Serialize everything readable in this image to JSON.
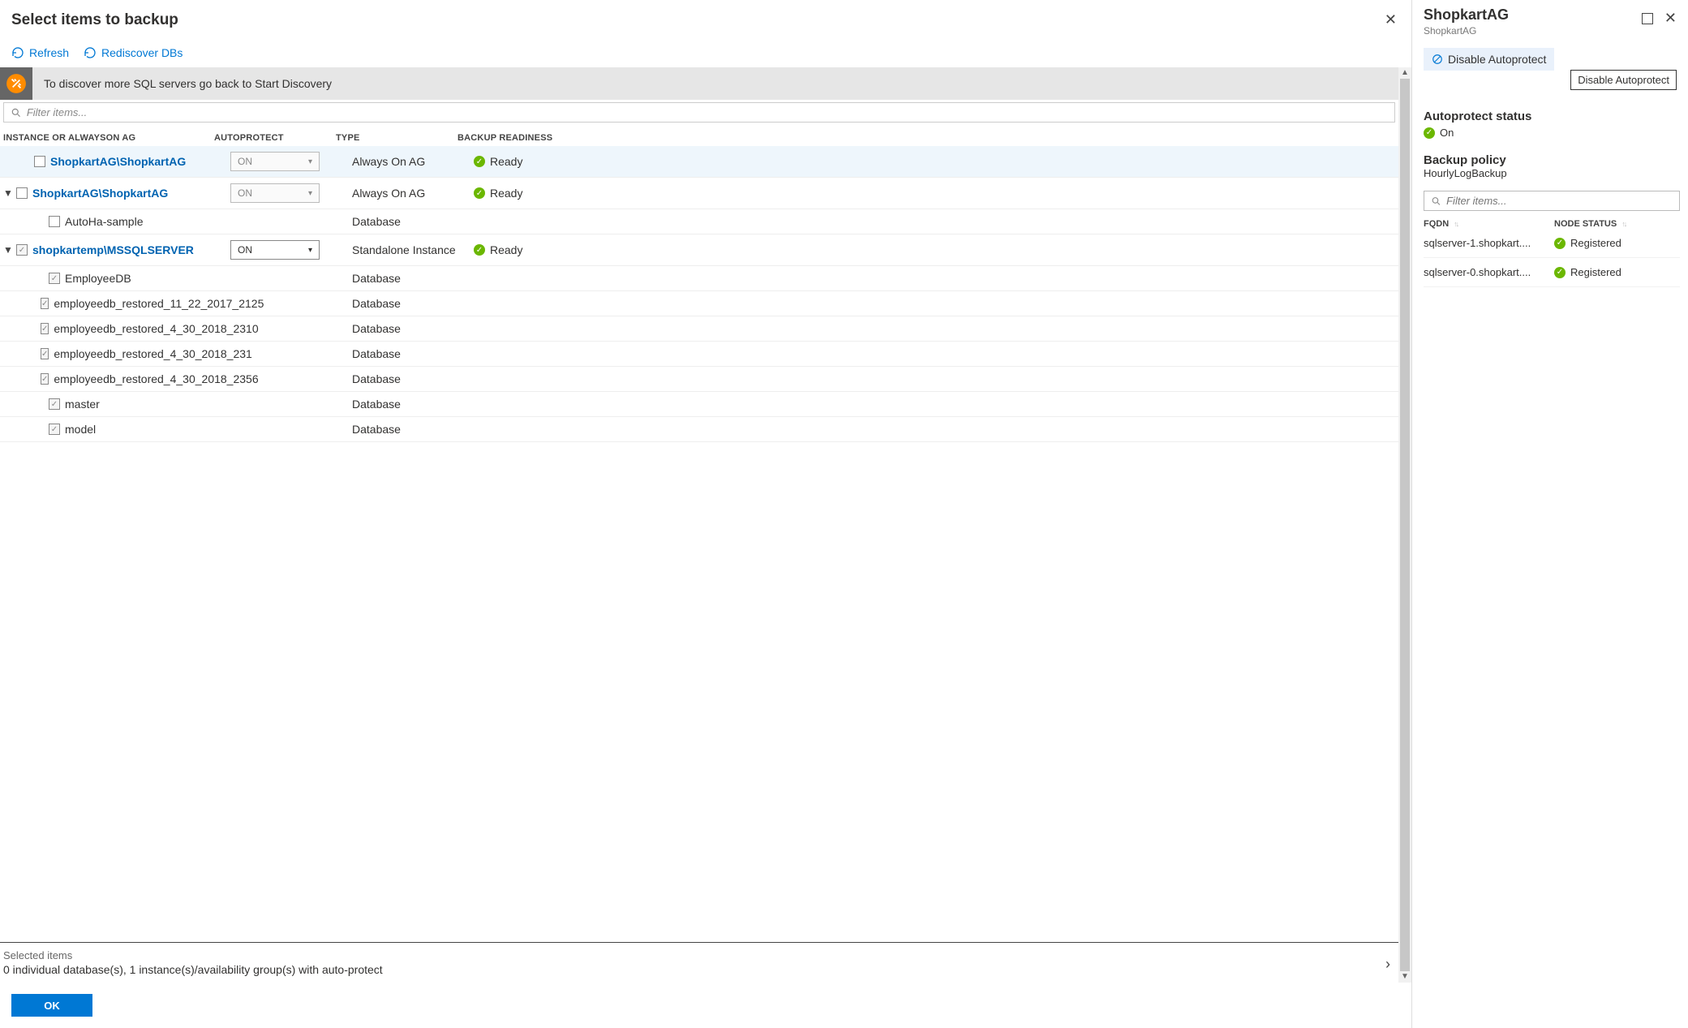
{
  "left": {
    "title": "Select items to backup",
    "toolbar": {
      "refresh": "Refresh",
      "rediscover": "Rediscover DBs"
    },
    "banner": "To discover more SQL servers go back to Start Discovery",
    "filter_placeholder": "Filter items...",
    "columns": {
      "name": "INSTANCE OR ALWAYSON AG",
      "autoprotect": "AUTOPROTECT",
      "type": "TYPE",
      "readiness": "BACKUP READINESS"
    },
    "rows": [
      {
        "caret": "",
        "indent": 1,
        "checked": false,
        "dim": false,
        "link": true,
        "name": "ShopkartAG\\ShopkartAG",
        "ap": "ON",
        "apDim": true,
        "type": "Always On AG",
        "ready": "Ready",
        "readyIcon": true,
        "highlight": true
      },
      {
        "caret": "▼",
        "indent": 0,
        "checked": false,
        "dim": false,
        "link": true,
        "name": "ShopkartAG\\ShopkartAG",
        "ap": "ON",
        "apDim": true,
        "type": "Always On AG",
        "ready": "Ready",
        "readyIcon": true,
        "highlight": false
      },
      {
        "caret": "",
        "indent": 2,
        "checked": false,
        "dim": false,
        "link": false,
        "name": "AutoHa-sample",
        "ap": "",
        "apDim": false,
        "type": "Database",
        "ready": "",
        "readyIcon": false,
        "highlight": false
      },
      {
        "caret": "▼",
        "indent": 0,
        "checked": true,
        "dim": true,
        "link": true,
        "name": "shopkartemp\\MSSQLSERVER",
        "ap": "ON",
        "apDim": false,
        "type": "Standalone Instance",
        "ready": "Ready",
        "readyIcon": true,
        "highlight": false
      },
      {
        "caret": "",
        "indent": 2,
        "checked": true,
        "dim": true,
        "link": false,
        "name": "EmployeeDB",
        "ap": "",
        "apDim": false,
        "type": "Database",
        "ready": "",
        "readyIcon": false,
        "highlight": false
      },
      {
        "caret": "",
        "indent": 2,
        "checked": true,
        "dim": true,
        "link": false,
        "name": "employeedb_restored_11_22_2017_2125",
        "ap": "",
        "apDim": false,
        "type": "Database",
        "ready": "",
        "readyIcon": false,
        "highlight": false
      },
      {
        "caret": "",
        "indent": 2,
        "checked": true,
        "dim": true,
        "link": false,
        "name": "employeedb_restored_4_30_2018_2310",
        "ap": "",
        "apDim": false,
        "type": "Database",
        "ready": "",
        "readyIcon": false,
        "highlight": false
      },
      {
        "caret": "",
        "indent": 2,
        "checked": true,
        "dim": true,
        "link": false,
        "name": "employeedb_restored_4_30_2018_231",
        "ap": "",
        "apDim": false,
        "type": "Database",
        "ready": "",
        "readyIcon": false,
        "highlight": false
      },
      {
        "caret": "",
        "indent": 2,
        "checked": true,
        "dim": true,
        "link": false,
        "name": "employeedb_restored_4_30_2018_2356",
        "ap": "",
        "apDim": false,
        "type": "Database",
        "ready": "",
        "readyIcon": false,
        "highlight": false
      },
      {
        "caret": "",
        "indent": 2,
        "checked": true,
        "dim": true,
        "link": false,
        "name": "master",
        "ap": "",
        "apDim": false,
        "type": "Database",
        "ready": "",
        "readyIcon": false,
        "highlight": false
      },
      {
        "caret": "",
        "indent": 2,
        "checked": true,
        "dim": true,
        "link": false,
        "name": "model",
        "ap": "",
        "apDim": false,
        "type": "Database",
        "ready": "",
        "readyIcon": false,
        "highlight": false
      }
    ],
    "selected": {
      "label": "Selected items",
      "summary": "0 individual database(s), 1 instance(s)/availability group(s) with auto-protect"
    },
    "ok": "OK"
  },
  "right": {
    "title": "ShopkartAG",
    "subtitle": "ShopkartAG",
    "disable_btn": "Disable Autoprotect",
    "tooltip": "Disable Autoprotect",
    "status_title": "Autoprotect status",
    "status_value": "On",
    "policy_title": "Backup policy",
    "policy_value": "HourlyLogBackup",
    "filter_placeholder": "Filter items...",
    "cols": {
      "fqdn": "FQDN",
      "status": "NODE STATUS"
    },
    "nodes": [
      {
        "fqdn": "sqlserver-1.shopkart....",
        "status": "Registered"
      },
      {
        "fqdn": "sqlserver-0.shopkart....",
        "status": "Registered"
      }
    ]
  }
}
